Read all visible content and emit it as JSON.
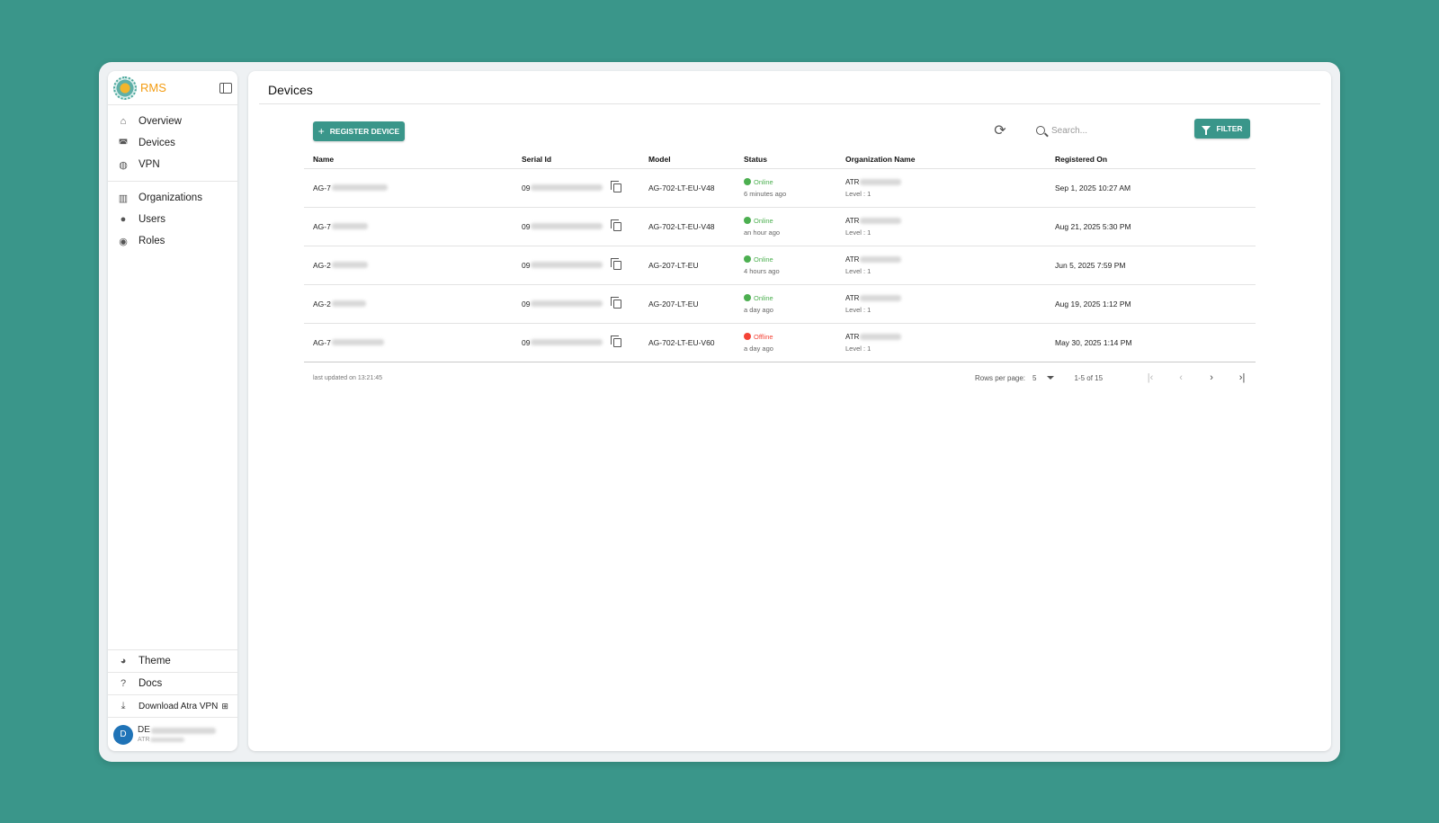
{
  "sidebar": {
    "brand": "RMS",
    "nav_primary": [
      {
        "label": "Overview",
        "icon": "home-icon"
      },
      {
        "label": "Devices",
        "icon": "router-icon"
      },
      {
        "label": "VPN",
        "icon": "globe-vpn-icon"
      }
    ],
    "nav_admin": [
      {
        "label": "Organizations",
        "icon": "building-icon"
      },
      {
        "label": "Users",
        "icon": "user-icon"
      },
      {
        "label": "Roles",
        "icon": "roles-icon"
      }
    ],
    "bottom": {
      "theme": "Theme",
      "docs": "Docs",
      "download": "Download Atra VPN"
    },
    "user": {
      "initials": "D",
      "name_visible": "DE",
      "org_visible": "ATR"
    }
  },
  "main": {
    "title": "Devices",
    "register_label": "REGISTER DEVICE",
    "search_placeholder": "Search...",
    "filter_label": "FILTER",
    "columns": [
      "Name",
      "Serial Id",
      "Model",
      "Status",
      "Organization Name",
      "Registered On"
    ],
    "rows": [
      {
        "name": "AG-7",
        "serial": "09",
        "model": "AG-702-LT-EU-V48",
        "status": "Online",
        "status_color": "#4caf50",
        "last_seen": "6 minutes ago",
        "org": "ATR",
        "level": "Level : 1",
        "registered": "Sep 1, 2025 10:27 AM"
      },
      {
        "name": "AG-7",
        "serial": "09",
        "model": "AG-702-LT-EU-V48",
        "status": "Online",
        "status_color": "#4caf50",
        "last_seen": "an hour ago",
        "org": "ATR",
        "level": "Level : 1",
        "registered": "Aug 21, 2025 5:30 PM"
      },
      {
        "name": "AG-2",
        "serial": "09",
        "model": "AG-207-LT-EU",
        "status": "Online",
        "status_color": "#4caf50",
        "last_seen": "4 hours ago",
        "org": "ATR",
        "level": "Level : 1",
        "registered": "Jun 5, 2025 7:59 PM"
      },
      {
        "name": "AG-2",
        "serial": "09",
        "model": "AG-207-LT-EU",
        "status": "Online",
        "status_color": "#4caf50",
        "last_seen": "a day ago",
        "org": "ATR",
        "level": "Level : 1",
        "registered": "Aug 19, 2025 1:12 PM"
      },
      {
        "name": "AG-7",
        "serial": "09",
        "model": "AG-702-LT-EU-V60",
        "status": "Offline",
        "status_color": "#f44336",
        "last_seen": "a day ago",
        "org": "ATR",
        "level": "Level : 1",
        "registered": "May 30, 2025 1:14 PM"
      }
    ],
    "footer": {
      "last_updated": "last updated on 13:21:45",
      "rows_per_page_label": "Rows per page:",
      "rows_per_page_value": "5",
      "range": "1-5 of 15"
    }
  },
  "colors": {
    "accent": "#3a968a",
    "brand": "#f39c12",
    "online": "#4caf50",
    "offline": "#f44336"
  }
}
